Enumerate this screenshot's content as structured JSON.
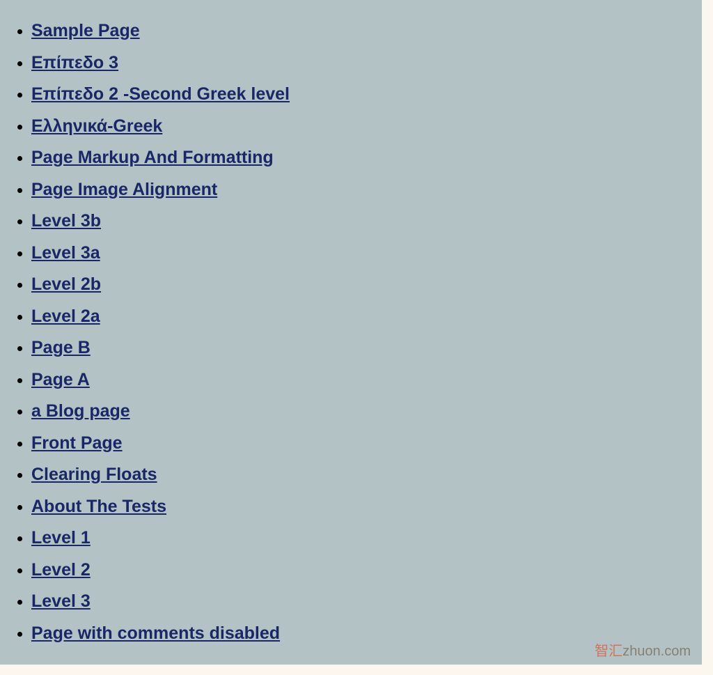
{
  "links": [
    "Sample Page",
    "Επίπεδο 3",
    "Επίπεδο 2 -Second Greek level",
    "Ελληνικά-Greek",
    "Page Markup And Formatting",
    "Page Image Alignment",
    "Level 3b",
    "Level 3a",
    "Level 2b",
    "Level 2a",
    "Page B",
    "Page A",
    "a Blog page",
    "Front Page",
    "Clearing Floats",
    "About The Tests",
    "Level 1",
    "Level 2",
    "Level 3",
    "Page with comments disabled"
  ],
  "watermark": {
    "cn": "智汇",
    "en": "zhuon.com"
  }
}
